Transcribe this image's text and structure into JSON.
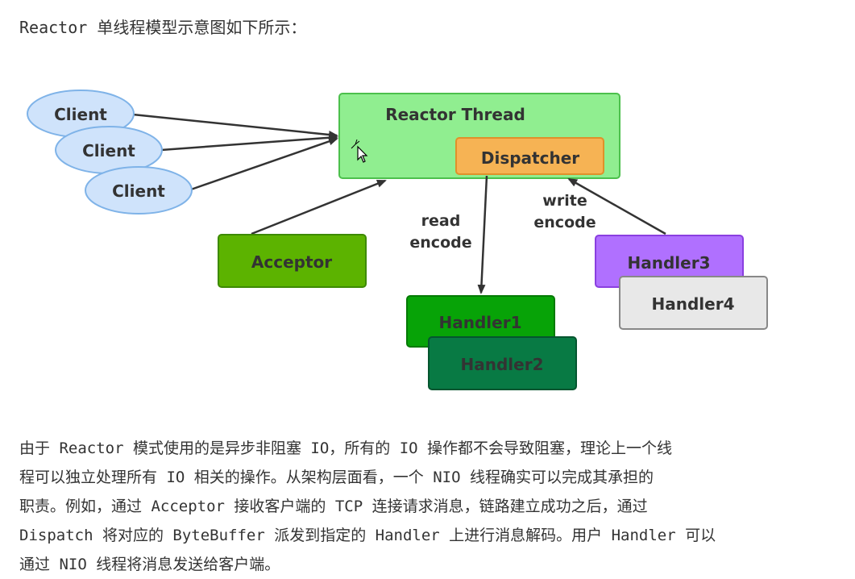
{
  "heading": "Reactor 单线程模型示意图如下所示：",
  "diagram": {
    "clients": [
      "Client",
      "Client",
      "Client"
    ],
    "reactor_thread": "Reactor Thread",
    "dispatcher": "Dispatcher",
    "acceptor": "Acceptor",
    "handlers": [
      "Handler1",
      "Handler2",
      "Handler3",
      "Handler4"
    ],
    "read_label": [
      "read",
      "encode"
    ],
    "write_label": [
      "write",
      "encode"
    ],
    "colors": {
      "client_fill": "#cfe3fb",
      "client_border": "#7fb3e8",
      "reactor_fill": "#90ee90",
      "reactor_border": "#4cc04c",
      "dispatcher_fill": "#f6b354",
      "acceptor_fill": "#5cb300",
      "handler1_fill": "#07a307",
      "handler2_fill": "#087a44",
      "handler3_fill": "#b070ff",
      "handler4_fill": "#e8e8e8"
    }
  },
  "paragraph": [
    "由于 Reactor 模式使用的是异步非阻塞 IO，所有的 IO 操作都不会导致阻塞，理论上一个线",
    "程可以独立处理所有 IO 相关的操作。从架构层面看，一个 NIO 线程确实可以完成其承担的",
    "职责。例如，通过 Acceptor 接收客户端的 TCP 连接请求消息，链路建立成功之后，通过",
    "Dispatch 将对应的 ByteBuffer 派发到指定的 Handler 上进行消息解码。用户 Handler 可以",
    "通过 NIO 线程将消息发送给客户端。"
  ]
}
